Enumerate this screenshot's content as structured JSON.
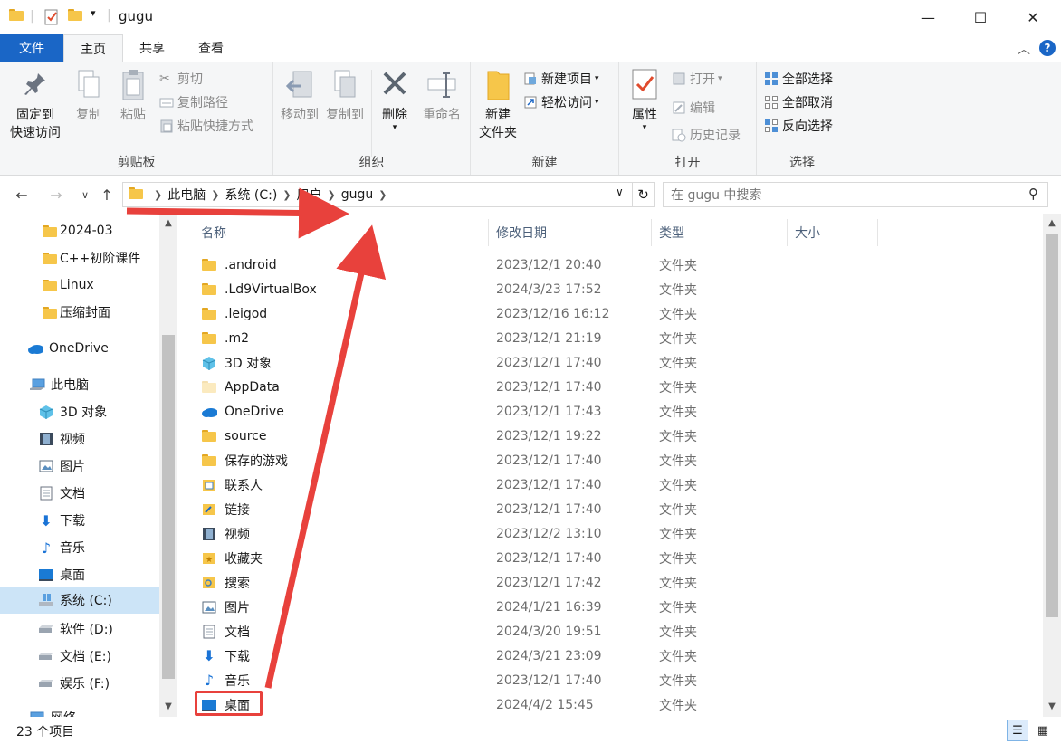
{
  "window": {
    "title": "gugu",
    "controls": {
      "minimize": "—",
      "maximize": "☐",
      "close": "✕"
    }
  },
  "ribbon_tabs": [
    {
      "label": "文件",
      "active": false
    },
    {
      "label": "主页",
      "active": true
    },
    {
      "label": "共享",
      "active": false
    },
    {
      "label": "查看",
      "active": false
    }
  ],
  "ribbon": {
    "clipboard": {
      "label": "剪贴板",
      "pin": "固定到\n快速访问",
      "copy": "复制",
      "paste": "粘贴",
      "cut": "剪切",
      "copy_path": "复制路径",
      "paste_shortcut": "粘贴快捷方式"
    },
    "organize": {
      "label": "组织",
      "move_to": "移动到",
      "copy_to": "复制到",
      "delete": "删除",
      "rename": "重命名"
    },
    "new": {
      "label": "新建",
      "new_folder": "新建\n文件夹",
      "new_item": "新建项目",
      "easy_access": "轻松访问"
    },
    "open": {
      "label": "打开",
      "properties": "属性",
      "open": "打开",
      "edit": "编辑",
      "history": "历史记录"
    },
    "select": {
      "label": "选择",
      "select_all": "全部选择",
      "select_none": "全部取消",
      "invert": "反向选择"
    }
  },
  "address": {
    "crumbs": [
      "此电脑",
      "系统 (C:)",
      "用户",
      "gugu"
    ],
    "search_placeholder": "在 gugu 中搜索"
  },
  "nav_pane": {
    "items": [
      {
        "label": "2024-03",
        "icon": "folder-icon"
      },
      {
        "label": "C++初阶课件",
        "icon": "folder-icon"
      },
      {
        "label": "Linux",
        "icon": "folder-icon"
      },
      {
        "label": "压缩封面",
        "icon": "folder-icon"
      },
      {
        "label": "OneDrive",
        "icon": "onedrive-icon"
      },
      {
        "label": "此电脑",
        "icon": "computer-icon"
      },
      {
        "label": "3D 对象",
        "icon": "3d-objects-icon"
      },
      {
        "label": "视频",
        "icon": "video-icon"
      },
      {
        "label": "图片",
        "icon": "pictures-icon"
      },
      {
        "label": "文档",
        "icon": "documents-icon"
      },
      {
        "label": "下载",
        "icon": "downloads-icon"
      },
      {
        "label": "音乐",
        "icon": "music-icon"
      },
      {
        "label": "桌面",
        "icon": "desktop-icon"
      },
      {
        "label": "系统 (C:)",
        "icon": "system-drive-icon",
        "selected": true
      },
      {
        "label": "软件 (D:)",
        "icon": "drive-icon"
      },
      {
        "label": "文档 (E:)",
        "icon": "drive-icon"
      },
      {
        "label": "娱乐 (F:)",
        "icon": "drive-icon"
      },
      {
        "label": "网络",
        "icon": "network-icon"
      }
    ]
  },
  "columns": {
    "name": "名称",
    "date": "修改日期",
    "type": "类型",
    "size": "大小"
  },
  "files": [
    {
      "name": ".android",
      "date": "2023/12/1 20:40",
      "type": "文件夹",
      "icon": "folder-icon"
    },
    {
      "name": ".Ld9VirtualBox",
      "date": "2024/3/23 17:52",
      "type": "文件夹",
      "icon": "folder-icon"
    },
    {
      "name": ".leigod",
      "date": "2023/12/16 16:12",
      "type": "文件夹",
      "icon": "folder-icon"
    },
    {
      "name": ".m2",
      "date": "2023/12/1 21:19",
      "type": "文件夹",
      "icon": "folder-icon"
    },
    {
      "name": "3D 对象",
      "date": "2023/12/1 17:40",
      "type": "文件夹",
      "icon": "3d-objects-icon"
    },
    {
      "name": "AppData",
      "date": "2023/12/1 17:40",
      "type": "文件夹",
      "icon": "folder-faded-icon"
    },
    {
      "name": "OneDrive",
      "date": "2023/12/1 17:43",
      "type": "文件夹",
      "icon": "onedrive-icon"
    },
    {
      "name": "source",
      "date": "2023/12/1 19:22",
      "type": "文件夹",
      "icon": "folder-icon"
    },
    {
      "name": "保存的游戏",
      "date": "2023/12/1 17:40",
      "type": "文件夹",
      "icon": "saved-games-icon"
    },
    {
      "name": "联系人",
      "date": "2023/12/1 17:40",
      "type": "文件夹",
      "icon": "contacts-icon"
    },
    {
      "name": "链接",
      "date": "2023/12/1 17:40",
      "type": "文件夹",
      "icon": "links-icon"
    },
    {
      "name": "视频",
      "date": "2023/12/2 13:10",
      "type": "文件夹",
      "icon": "video-icon"
    },
    {
      "name": "收藏夹",
      "date": "2023/12/1 17:40",
      "type": "文件夹",
      "icon": "favorites-icon"
    },
    {
      "name": "搜索",
      "date": "2023/12/1 17:42",
      "type": "文件夹",
      "icon": "searches-icon"
    },
    {
      "name": "图片",
      "date": "2024/1/21 16:39",
      "type": "文件夹",
      "icon": "pictures-icon"
    },
    {
      "name": "文档",
      "date": "2024/3/20 19:51",
      "type": "文件夹",
      "icon": "documents-icon"
    },
    {
      "name": "下载",
      "date": "2024/3/21 23:09",
      "type": "文件夹",
      "icon": "downloads-icon"
    },
    {
      "name": "音乐",
      "date": "2023/12/1 17:40",
      "type": "文件夹",
      "icon": "music-icon"
    },
    {
      "name": "桌面",
      "date": "2024/4/2 15:45",
      "type": "文件夹",
      "icon": "desktop-icon",
      "highlighted": true
    }
  ],
  "status": {
    "item_count": "23 个项目"
  },
  "colors": {
    "accent": "#1a66c6",
    "selection": "#cce4f7",
    "annotation": "#e8413c",
    "folder": "#f6c64a"
  }
}
